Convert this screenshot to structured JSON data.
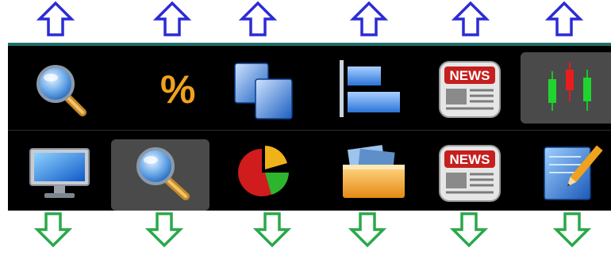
{
  "colors": {
    "up_arrow": "#2b2bd6",
    "down_arrow": "#2aa84a",
    "toolbar_bg": "#000000",
    "accent_line": "#1f6f6a",
    "selected_bg": "#4a4a4a"
  },
  "toolbar": {
    "top_row": [
      {
        "icon": "search-icon"
      },
      {
        "icon": "percent-icon",
        "glyph": "%"
      },
      {
        "icon": "copy-icon"
      },
      {
        "icon": "align-left-icon"
      },
      {
        "icon": "news-icon",
        "text": "NEWS"
      },
      {
        "icon": "candlestick-chart-icon",
        "selected": true
      }
    ],
    "bottom_row": [
      {
        "icon": "monitor-icon"
      },
      {
        "icon": "search-icon",
        "selected": true
      },
      {
        "icon": "pie-chart-icon"
      },
      {
        "icon": "folder-icon"
      },
      {
        "icon": "news-icon",
        "text": "NEWS"
      },
      {
        "icon": "edit-icon"
      }
    ]
  }
}
